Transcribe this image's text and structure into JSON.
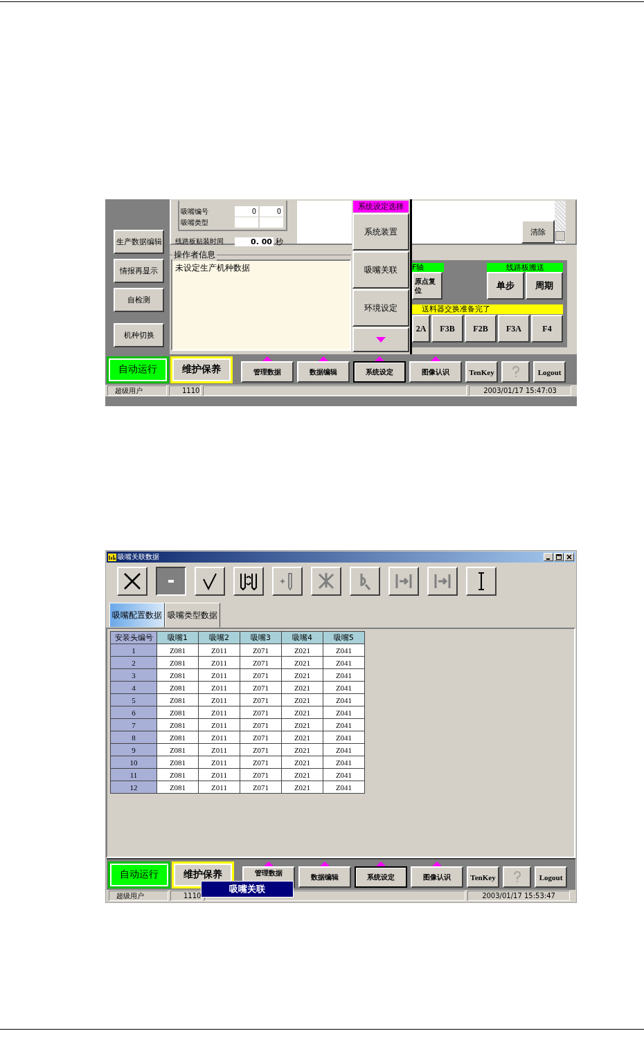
{
  "control_screen": {
    "side_buttons": [
      "生产数据编辑",
      "情报再显示",
      "自检测",
      "机种切换"
    ],
    "params": [
      {
        "label": "吸嘴编号",
        "values": [
          "0",
          "0"
        ]
      },
      {
        "label": "吸嘴类型"
      }
    ],
    "mount_time": {
      "label": "线路板贴装时间",
      "value": "0. 00",
      "unit": "秒"
    },
    "clear_button": "清除",
    "operator_info": {
      "title": "操作者信息",
      "message": "未设定生产机种数据"
    },
    "popup_menu": {
      "title": "系统设定选择",
      "items": [
        "系统装置",
        "吸嘴关联",
        "环境设定"
      ]
    },
    "axis": {
      "label": "F轴",
      "button": "原点复位"
    },
    "transport": {
      "label": "线路板搬送",
      "buttons": [
        "单步",
        "周期"
      ]
    },
    "feeder": {
      "status": "送料器交换准备完了",
      "buttons": [
        "2A",
        "F3B",
        "F2B",
        "F3A",
        "F4"
      ]
    },
    "bottom_bar": {
      "mode_buttons": [
        {
          "label": "自动运行",
          "kind": "auto"
        },
        {
          "label": "维护保养",
          "kind": "maintenance"
        }
      ],
      "menu_buttons": [
        {
          "kind": "text",
          "label": "管理数据",
          "selected": false,
          "submenu": true
        },
        {
          "kind": "text",
          "label": "数据编辑",
          "selected": false,
          "submenu": true
        },
        {
          "kind": "text",
          "label": "系统设定",
          "selected": true,
          "submenu": true
        },
        {
          "kind": "text",
          "label": "图像认识",
          "selected": false,
          "submenu": true
        },
        {
          "kind": "text",
          "label": "TenKey",
          "selected": false,
          "submenu": false
        },
        {
          "kind": "help",
          "selected": false,
          "submenu": false
        },
        {
          "kind": "text",
          "label": "Logout",
          "selected": false,
          "submenu": false
        }
      ]
    },
    "status_bar": {
      "user": "超级用户",
      "code": "1110",
      "datetime": "2003/01/17 15:47:03"
    }
  },
  "nozzle_window": {
    "title": "吸嘴关联数据",
    "toolbar": [
      {
        "kind": "close",
        "disabled": false,
        "pressed": false
      },
      {
        "kind": "square",
        "disabled": false,
        "pressed": true
      },
      {
        "kind": "check",
        "disabled": false,
        "pressed": false
      },
      {
        "kind": "swap",
        "disabled": false,
        "pressed": false
      },
      {
        "kind": "add",
        "disabled": true,
        "pressed": false
      },
      {
        "kind": "delete",
        "disabled": true,
        "pressed": false
      },
      {
        "kind": "find",
        "disabled": true,
        "pressed": false
      },
      {
        "kind": "jump",
        "disabled": true,
        "pressed": false
      },
      {
        "kind": "jump",
        "disabled": true,
        "pressed": false
      },
      {
        "kind": "cursor",
        "disabled": false,
        "pressed": false
      }
    ],
    "tabs": [
      {
        "label": "吸嘴配置数据",
        "selected": true
      },
      {
        "label": "吸嘴类型数据",
        "selected": false
      }
    ],
    "table": {
      "columns": [
        "安装头编号",
        "吸嘴1",
        "吸嘴2",
        "吸嘴3",
        "吸嘴4",
        "吸嘴5"
      ],
      "rows": [
        [
          "1",
          "Z081",
          "Z011",
          "Z071",
          "Z021",
          "Z041"
        ],
        [
          "2",
          "Z081",
          "Z011",
          "Z071",
          "Z021",
          "Z041"
        ],
        [
          "3",
          "Z081",
          "Z011",
          "Z071",
          "Z021",
          "Z041"
        ],
        [
          "4",
          "Z081",
          "Z011",
          "Z071",
          "Z021",
          "Z041"
        ],
        [
          "5",
          "Z081",
          "Z011",
          "Z071",
          "Z021",
          "Z041"
        ],
        [
          "6",
          "Z081",
          "Z011",
          "Z071",
          "Z021",
          "Z041"
        ],
        [
          "7",
          "Z081",
          "Z011",
          "Z071",
          "Z021",
          "Z041"
        ],
        [
          "8",
          "Z081",
          "Z011",
          "Z071",
          "Z021",
          "Z041"
        ],
        [
          "9",
          "Z081",
          "Z011",
          "Z071",
          "Z021",
          "Z041"
        ],
        [
          "10",
          "Z081",
          "Z011",
          "Z071",
          "Z021",
          "Z041"
        ],
        [
          "11",
          "Z081",
          "Z011",
          "Z071",
          "Z021",
          "Z041"
        ],
        [
          "12",
          "Z081",
          "Z011",
          "Z071",
          "Z021",
          "Z041"
        ]
      ]
    },
    "bottom_bar": {
      "mode_buttons": [
        {
          "label": "自动运行",
          "kind": "auto"
        },
        {
          "label": "维护保养",
          "kind": "maintenance"
        }
      ],
      "menu_buttons": [
        {
          "kind": "text",
          "label": "管理数据",
          "selected": false,
          "submenu": true
        },
        {
          "kind": "text",
          "label": "数据编辑",
          "selected": false,
          "submenu": true
        },
        {
          "kind": "text",
          "label": "系统设定",
          "selected": true,
          "submenu": true
        },
        {
          "kind": "text",
          "label": "图像认识",
          "selected": false,
          "submenu": true
        },
        {
          "kind": "text",
          "label": "TenKey",
          "selected": false,
          "submenu": false
        },
        {
          "kind": "help",
          "selected": false,
          "submenu": false
        },
        {
          "kind": "text",
          "label": "Logout",
          "selected": false,
          "submenu": false
        }
      ]
    },
    "tooltip": "吸嘴关联",
    "status_bar": {
      "user": "超级用户",
      "code": "1110",
      "datetime": "2003/01/17 15:53:47"
    }
  }
}
